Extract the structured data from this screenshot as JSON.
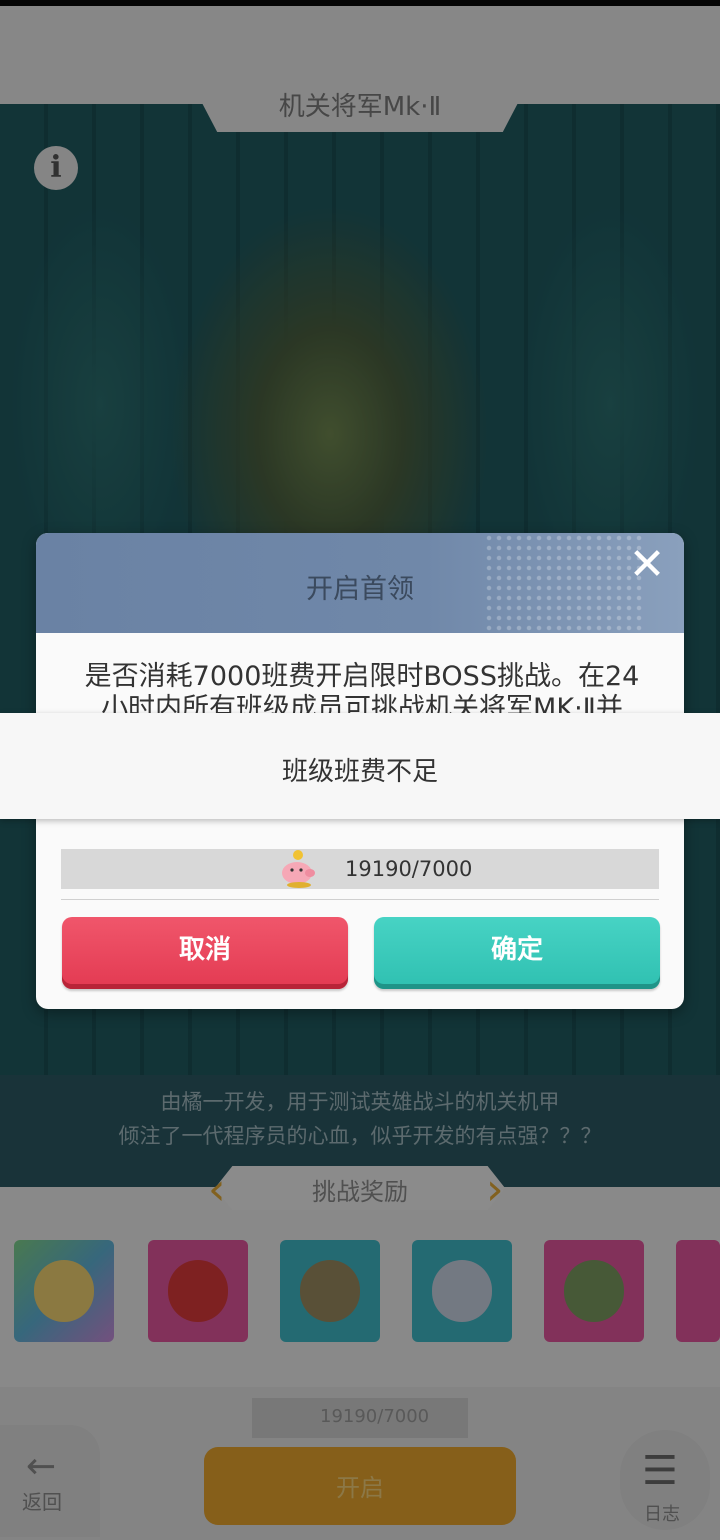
{
  "background": {
    "boss_title": "机关将军Mk·Ⅱ",
    "info_icon": "info-icon",
    "description_lines": [
      "由橘一开发，用于测试英雄战斗的机关机甲",
      "倾注了一代程序员的心血，似乎开发的有点强？？？"
    ],
    "reward_section_title": "挑战奖励",
    "reward_items": [
      {
        "name": "ring-item",
        "color": "#5fb2d6"
      },
      {
        "name": "red-orb-item",
        "color": "#e0559c"
      },
      {
        "name": "dagger-item",
        "color": "#3fb7c4"
      },
      {
        "name": "armor-item",
        "color": "#3fb7c4"
      },
      {
        "name": "sword-item",
        "color": "#e0559c"
      },
      {
        "name": "partial-item",
        "color": "#e0559c"
      }
    ],
    "bottom_cost": "19190/7000",
    "back_label": "返回",
    "start_label": "开启",
    "log_label": "日志"
  },
  "dialog": {
    "title": "开启首领",
    "message": "是否消耗7000班费开启限时BOSS挑战。在24小时内所有班级成员可挑战机关将军MK·Ⅱ并",
    "fund_value": "19190/7000",
    "cancel_label": "取消",
    "confirm_label": "确定",
    "close_icon": "close-icon"
  },
  "toast": {
    "text": "班级班费不足"
  },
  "colors": {
    "cancel": "#e33a52",
    "confirm": "#2fc0b1",
    "header": "#7088a9",
    "start": "#e7a42e"
  }
}
